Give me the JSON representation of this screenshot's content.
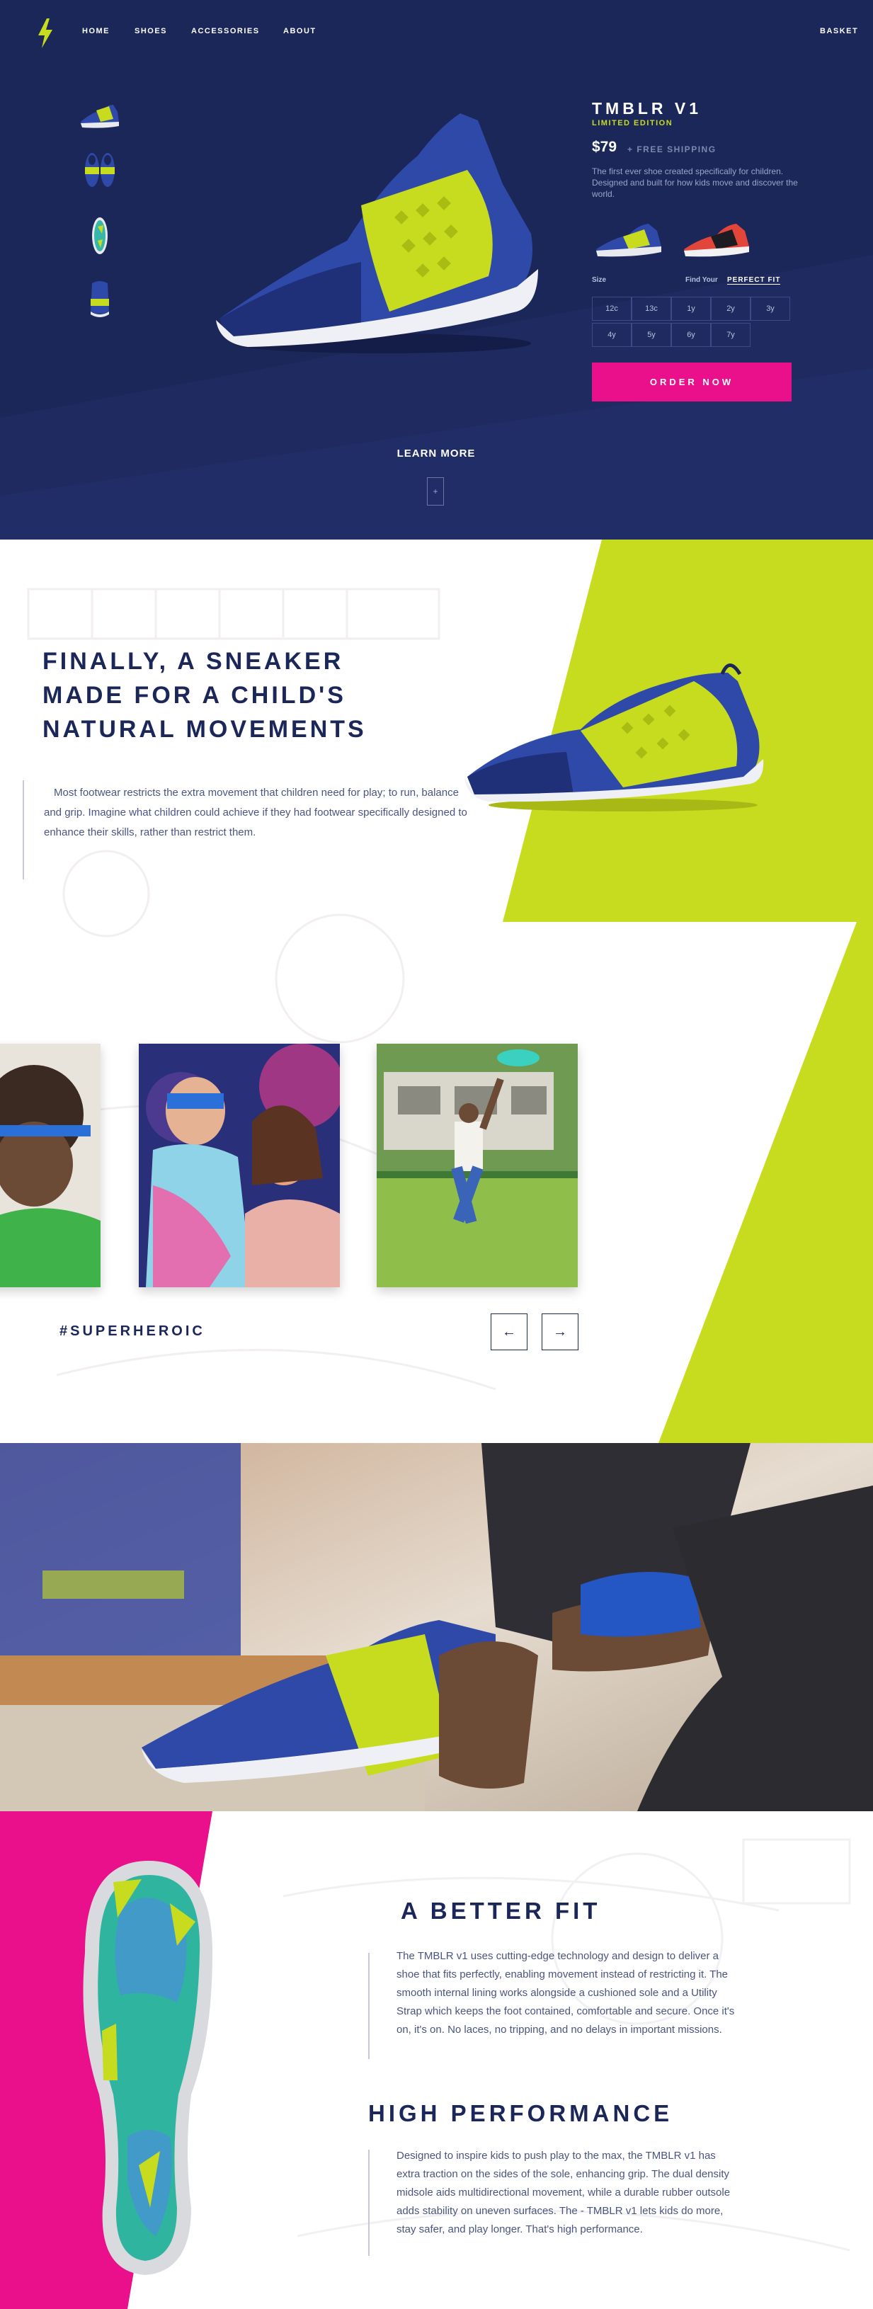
{
  "nav": {
    "links": [
      "HOME",
      "SHOES",
      "ACCESSORIES",
      "ABOUT"
    ],
    "basket": "BASKET"
  },
  "product": {
    "title": "TMBLR V1",
    "edition": "LIMITED EDITION",
    "price": "$79",
    "shipping": "+ FREE SHIPPING",
    "description": "The first ever shoe created specifically for children. Designed and built for how kids move and discover the world.",
    "size_label": "Size",
    "fit_label": "Find Your",
    "fit_link": "PERFECT FIT",
    "sizes": [
      "12c",
      "13c",
      "1y",
      "2y",
      "3y",
      "4y",
      "5y",
      "6y",
      "7y"
    ],
    "order_button": "ORDER NOW"
  },
  "hero": {
    "learn_more": "LEARN MORE",
    "scroll_glyph": "+"
  },
  "sneaker_section": {
    "heading_lines": [
      "FINALLY, A SNEAKER",
      "MADE FOR A CHILD'S",
      "NATURAL MOVEMENTS"
    ],
    "body": "Most footwear restricts the extra movement that children need for play; to run, balance and grip. Imagine what children could achieve if they had footwear specifically designed to enhance their skills, rather than restrict them.",
    "hashtag": "#SUPERHEROIC",
    "prev_glyph": "←",
    "next_glyph": "→"
  },
  "fit_section": {
    "heading1": "A BETTER FIT",
    "paragraph1": "The TMBLR v1 uses cutting-edge technology and design to deliver a shoe that fits perfectly, enabling movement instead of restricting it. The smooth internal lining works alongside a cushioned sole and a Utility Strap which keeps the foot contained, comfortable and secure. Once it's on, it's on. No laces, no tripping, and no delays in important missions.",
    "heading2": "HIGH PERFORMANCE",
    "paragraph2": "Designed to inspire kids to push play to the max, the TMBLR v1 has extra traction on the sides of the sole, enhancing grip. The dual density midsole aids multidirectional movement, while a durable rubber outsole adds stability on uneven surfaces. The - TMBLR v1 lets kids do more, stay safer, and play longer. That's high performance."
  },
  "colors": {
    "navy": "#1b2659",
    "lime": "#c8dc1f",
    "pink": "#ea0f8a",
    "shoe_blue": "#2e49a8"
  }
}
